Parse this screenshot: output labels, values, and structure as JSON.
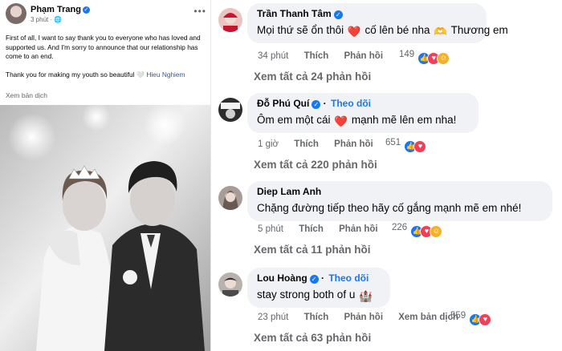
{
  "post": {
    "author": "Phạm Trang",
    "time": "3 phút",
    "paragraph1": "First of all, I want to say thank you to everyone who has loved and supported us. And I'm sorry to announce that our relationship has come to an end.",
    "paragraph2": "Thank you for making my youth so beautiful",
    "tagged": "Hieu Nghiem",
    "translate": "Xem bản dịch"
  },
  "comments": [
    {
      "name": "Trần Thanh Tâm",
      "follow": "",
      "text_a": "Mọi thứ sẽ ổn thôi",
      "text_b": "cố lên bé nha",
      "text_c": "Thương em",
      "time": "34 phút",
      "like": "Thích",
      "reply": "Phản hồi",
      "reaction_count": "149",
      "view_replies": "Xem tất cả 24 phản hồi"
    },
    {
      "name": "Đỗ Phú Quí",
      "follow": "Theo dõi",
      "text_a": "Ôm em một cái",
      "text_b": "mạnh mẽ lên em nha!",
      "time": "1 giờ",
      "like": "Thích",
      "reply": "Phản hồi",
      "reaction_count": "651",
      "view_replies": "Xem tất cả 220 phản hồi"
    },
    {
      "name": "Diep Lam Anh",
      "follow": "",
      "text_a": "Chặng đường tiếp theo hãy cố gắng mạnh mẽ em nhé!",
      "time": "5 phút",
      "like": "Thích",
      "reply": "Phản hồi",
      "reaction_count": "226",
      "view_replies": "Xem tất cả 11 phản hồi"
    },
    {
      "name": "Lou Hoàng",
      "follow": "Theo dõi",
      "text_a": "stay strong both of u",
      "time": "23 phút",
      "like": "Thích",
      "reply": "Phản hồi",
      "translate": "Xem bản dịch",
      "reaction_count": "559",
      "view_replies": "Xem tất cả 63 phản hồi"
    }
  ],
  "colors": {
    "link_blue": "#1877f2",
    "bubble_gray": "#f0f2f5",
    "meta_gray": "#65676b",
    "love_red": "#f33e58"
  },
  "icons": [
    "verified-badge-icon",
    "more-options-icon",
    "globe-icon",
    "heart-emoji-icon",
    "like-reaction-icon",
    "love-reaction-icon",
    "care-reaction-icon",
    "white-heart-emoji-icon",
    "hands-emoji-icon",
    "castle-emoji-icon"
  ]
}
